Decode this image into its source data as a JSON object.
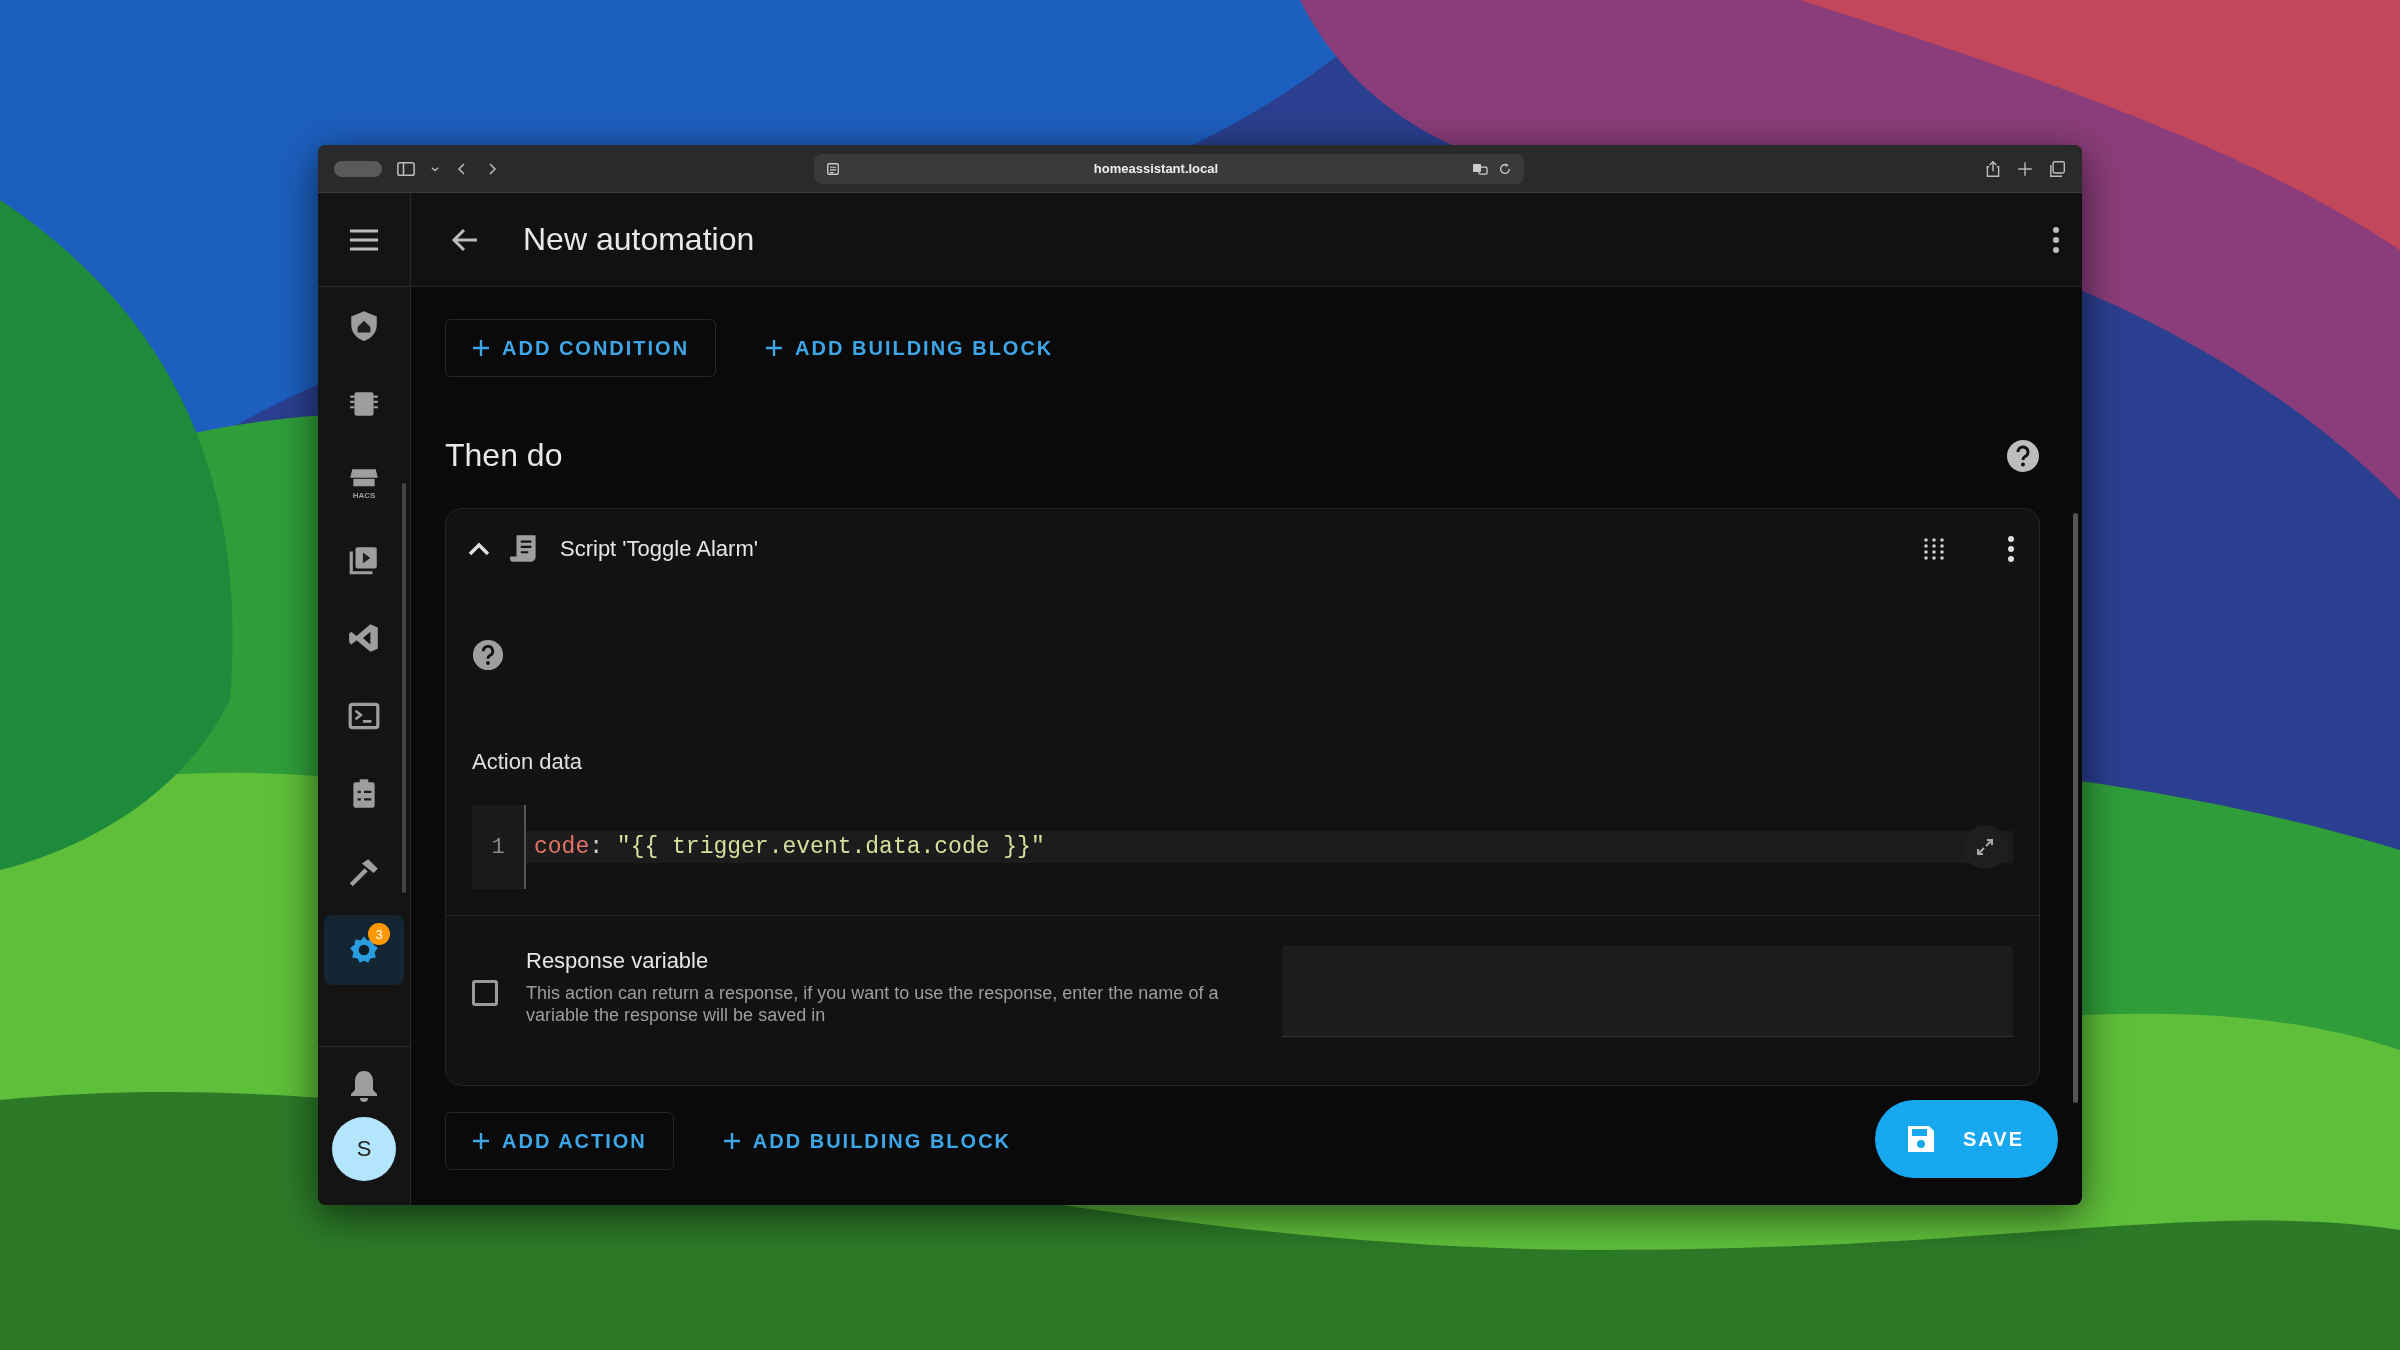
{
  "browser": {
    "url": "homeassistant.local"
  },
  "header": {
    "title": "New automation"
  },
  "sidebar": {
    "items": [
      {
        "selected": false
      },
      {
        "selected": false
      },
      {
        "selected": false,
        "icon_text": "HACS"
      },
      {
        "selected": false
      },
      {
        "selected": false
      },
      {
        "selected": false
      },
      {
        "selected": false
      },
      {
        "selected": false
      },
      {
        "selected": true,
        "badge": "3"
      }
    ],
    "avatar": "S"
  },
  "conditions": {
    "buttons": [
      {
        "label": "ADD CONDITION",
        "outlined": true
      },
      {
        "label": "ADD BUILDING BLOCK",
        "outlined": false
      }
    ]
  },
  "actions_section": {
    "title": "Then do"
  },
  "action_card": {
    "title": "Script 'Toggle Alarm'",
    "expanded": true,
    "data_label": "Action data",
    "code_lines": [
      {
        "number": "1",
        "key": "code",
        "separator": ":",
        "value": "\"{{ trigger.event.data.code }}\""
      }
    ],
    "response": {
      "checked": false,
      "title": "Response variable",
      "description": "This action can return a response, if you want to use the response, enter the name of a variable the response will be saved in"
    }
  },
  "actions": {
    "buttons": [
      {
        "label": "ADD ACTION",
        "outlined": true
      },
      {
        "label": "ADD BUILDING BLOCK",
        "outlined": false
      }
    ]
  },
  "save_button": {
    "label": "SAVE"
  }
}
